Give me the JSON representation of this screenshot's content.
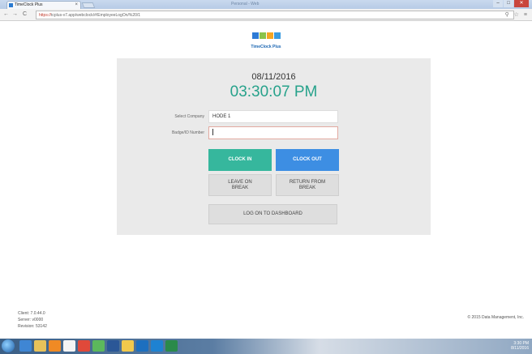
{
  "browser": {
    "tab_title": "TimeClock Plus",
    "tab_close": "×",
    "window_title": "Personal - Web",
    "url_secure": "https://",
    "url_rest": "tcplus-v7.app/webclock/#/EmployeeLogOn/%20/1",
    "nav": {
      "back": "←",
      "forward": "→",
      "reload": "C"
    },
    "toolbar_icons": "⚲ ☆ ≡",
    "window_controls": {
      "minimize": "–",
      "maximize": "□",
      "close": "✕"
    }
  },
  "logo": {
    "text": "TimeClock Plus",
    "colors": [
      "#2e7bd6",
      "#8bc34a",
      "#f5a623",
      "#3b9be0"
    ]
  },
  "clock": {
    "date": "08/11/2016",
    "time": "03:30:07 PM"
  },
  "form": {
    "company_label": "Select Company",
    "company_value": "HODE 1",
    "badge_label": "Badge/ID Number",
    "badge_value": ""
  },
  "buttons": {
    "clock_in": "CLOCK IN",
    "clock_out": "CLOCK OUT",
    "leave_on_break": "LEAVE ON BREAK",
    "return_from_break": "RETURN FROM BREAK",
    "log_on_dashboard": "LOG ON TO DASHBOARD"
  },
  "footer": {
    "client": "Client: 7.0.44.0",
    "server": "Server: v0000",
    "revision": "Revision: 53142",
    "copyright": "© 2015 Data Management, Inc."
  },
  "taskbar": {
    "items": [
      "start-orb",
      "ie-icon",
      "explorer-icon",
      "media-icon",
      "paint-icon",
      "chrome-icon",
      "app-icon",
      "word-icon",
      "folder-icon",
      "outlook-icon",
      "lync-icon",
      "excel-icon"
    ],
    "tray_time": "3:30 PM",
    "tray_date": "8/11/2016"
  },
  "colors": {
    "clock_in": "#36b79d",
    "clock_out": "#3d8ee3",
    "time_text": "#27a28b",
    "panel_bg": "#eaeaea"
  }
}
